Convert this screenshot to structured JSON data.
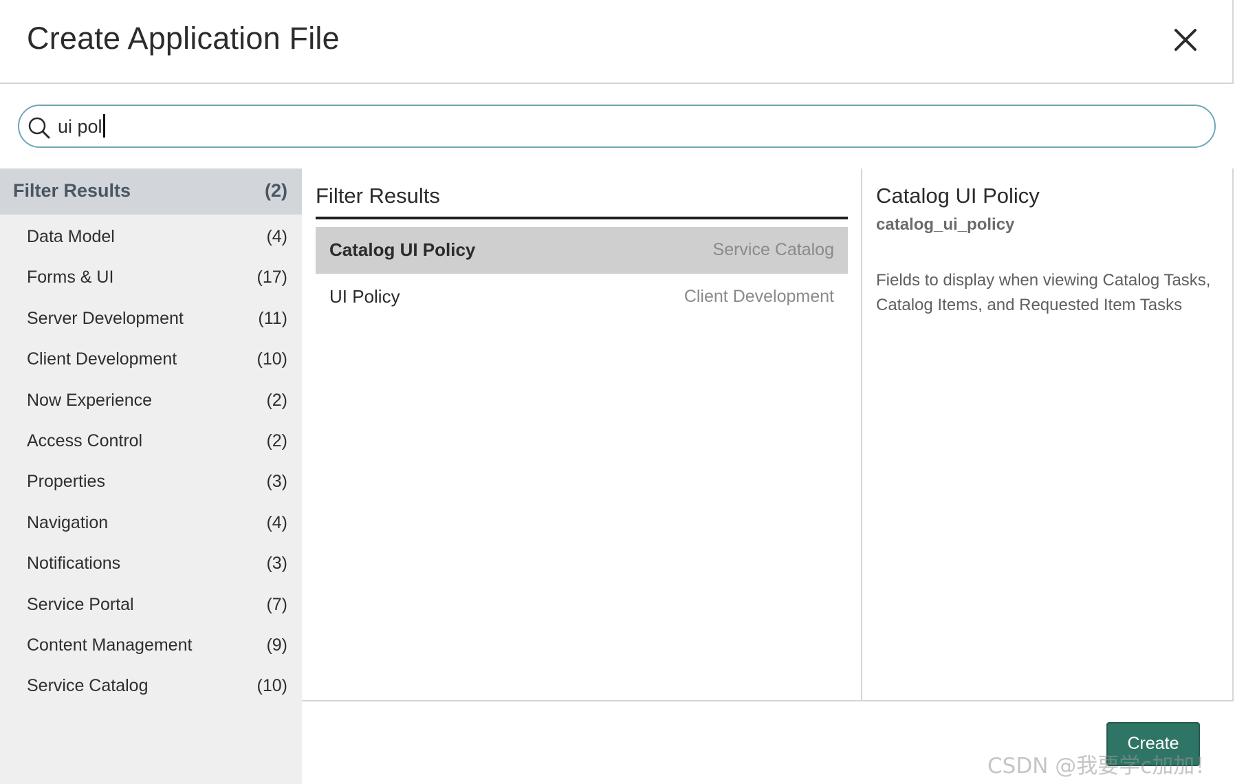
{
  "dialog": {
    "title": "Create Application File"
  },
  "search": {
    "value": "ui pol",
    "placeholder": ""
  },
  "categories": {
    "header": {
      "label": "Filter Results",
      "count": "(2)"
    },
    "items": [
      {
        "label": "Data Model",
        "count": "(4)"
      },
      {
        "label": "Forms & UI",
        "count": "(17)"
      },
      {
        "label": "Server Development",
        "count": "(11)"
      },
      {
        "label": "Client Development",
        "count": "(10)"
      },
      {
        "label": "Now Experience",
        "count": "(2)"
      },
      {
        "label": "Access Control",
        "count": "(2)"
      },
      {
        "label": "Properties",
        "count": "(3)"
      },
      {
        "label": "Navigation",
        "count": "(4)"
      },
      {
        "label": "Notifications",
        "count": "(3)"
      },
      {
        "label": "Service Portal",
        "count": "(7)"
      },
      {
        "label": "Content Management",
        "count": "(9)"
      },
      {
        "label": "Service Catalog",
        "count": "(10)"
      }
    ]
  },
  "results": {
    "heading": "Filter Results",
    "items": [
      {
        "name": "Catalog UI Policy",
        "category": "Service Catalog",
        "selected": true
      },
      {
        "name": "UI Policy",
        "category": "Client Development",
        "selected": false
      }
    ]
  },
  "detail": {
    "title": "Catalog UI Policy",
    "table": "catalog_ui_policy",
    "description": "Fields to display when viewing Catalog Tasks, Catalog Items, and Requested Item Tasks"
  },
  "footer": {
    "create_label": "Create"
  },
  "watermark": "CSDN @我要学c加加！",
  "colors": {
    "accent_border": "#6fa6b8",
    "create_button": "#2f7566",
    "category_header_bg": "#d2d5da",
    "selected_row_bg": "#cfcfcf",
    "sidebar_bg": "#efefef"
  },
  "icons": {
    "close": "close-icon",
    "search": "search-icon"
  }
}
